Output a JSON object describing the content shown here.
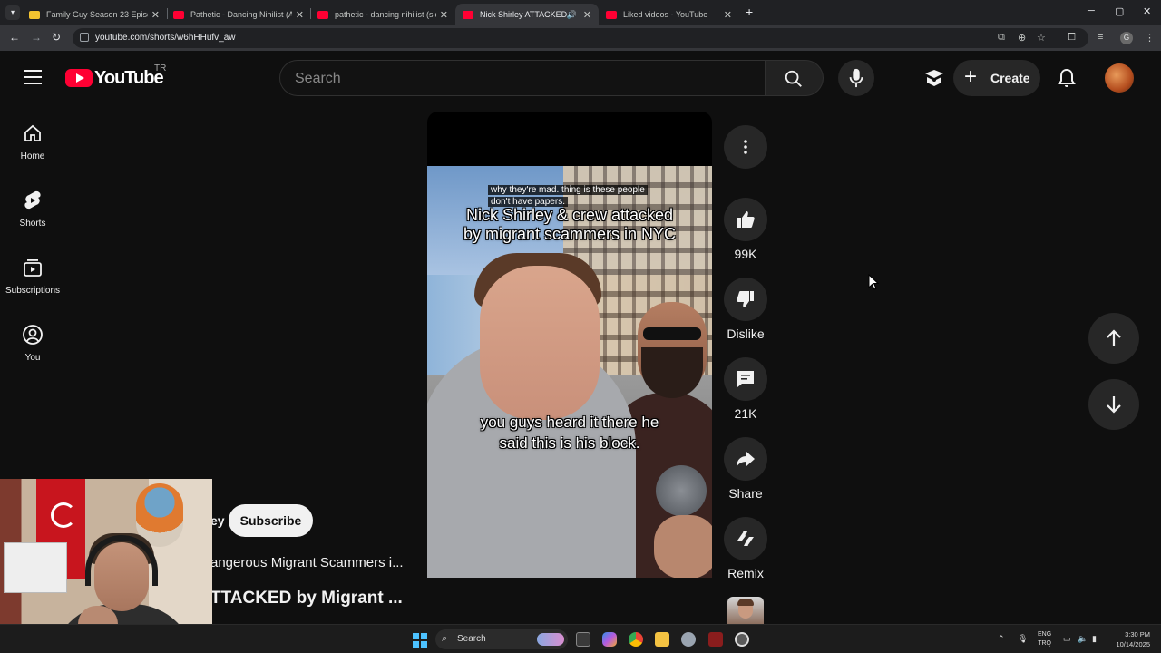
{
  "browser": {
    "tabs": [
      {
        "title": "Family Guy Season 23 Episode",
        "favicon": "folder-yellow-icon",
        "active": false
      },
      {
        "title": "Pathetic - Dancing Nihilist (Aus",
        "favicon": "youtube-icon",
        "active": false
      },
      {
        "title": "pathetic - dancing nihilist (slow",
        "favicon": "youtube-icon",
        "active": false
      },
      {
        "title": "Nick Shirley ATTACKED by M",
        "favicon": "youtube-icon",
        "active": true,
        "audio": true
      },
      {
        "title": "Liked videos - YouTube",
        "favicon": "youtube-icon",
        "active": false
      }
    ],
    "url": "youtube.com/shorts/w6hHHufv_aw",
    "profile_initial": "G"
  },
  "youtube": {
    "wordmark": "YouTube",
    "country": "TR",
    "search_placeholder": "Search",
    "create_label": "Create",
    "guide": [
      {
        "label": "Home",
        "icon": "home-icon"
      },
      {
        "label": "Shorts",
        "icon": "shorts-icon"
      },
      {
        "label": "Subscriptions",
        "icon": "subscriptions-icon"
      },
      {
        "label": "You",
        "icon": "you-icon"
      }
    ]
  },
  "short": {
    "captions": {
      "top_line1": "why they're mad. thing is these people",
      "top_line2": "don't have papers.",
      "title_line1": "Nick Shirley & crew attacked",
      "title_line2": "by migrant scammers in NYC",
      "sub_line1": "you guys heard it there he",
      "sub_line2": "said this is his block."
    },
    "actions": {
      "like_count": "99K",
      "dislike_label": "Dislike",
      "comment_count": "21K",
      "share_label": "Share",
      "remix_label": "Remix"
    },
    "channel_name_partial": "ey",
    "subscribe_label": "Subscribe",
    "description_partial": "angerous Migrant Scammers i...",
    "title_partial": "TTACKED by Migrant ..."
  },
  "taskbar": {
    "search_label": "Search",
    "lang_line1": "ENG",
    "lang_line2": "TRQ",
    "time": "3:30 PM",
    "date": "10/14/2025"
  }
}
